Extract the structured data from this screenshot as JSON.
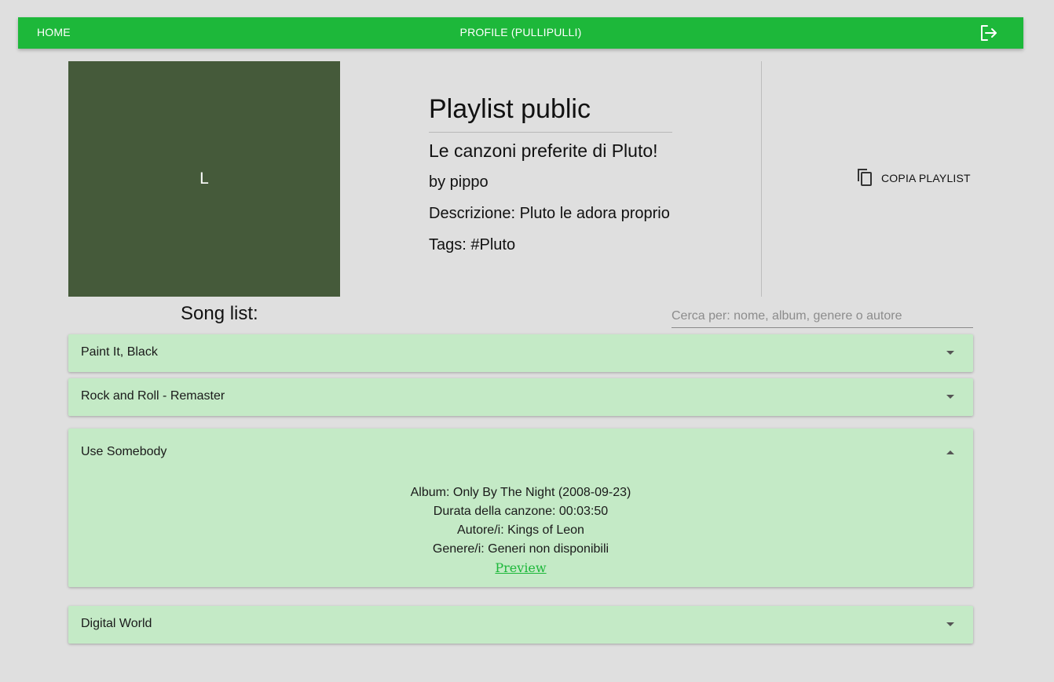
{
  "nav": {
    "home": "HOME",
    "profile": "PROFILE (PULLIPULLI)",
    "logout_icon": "logout-icon"
  },
  "playlist": {
    "cover_letter": "L",
    "cover_color": "#455a3a",
    "title": "Playlist public",
    "name": "Le canzoni preferite di Pluto!",
    "author": "by pippo",
    "description": "Descrizione: Pluto le adora proprio",
    "tags": "Tags: #Pluto"
  },
  "actions": {
    "copy_label": "COPIA PLAYLIST",
    "copy_icon": "copy-icon"
  },
  "songlist": {
    "label": "Song list:",
    "search_placeholder": "Cerca per: nome, album, genere o autore",
    "search_value": ""
  },
  "songs": [
    {
      "title": "Paint It, Black",
      "expanded": false
    },
    {
      "title": "Rock and Roll - Remaster",
      "expanded": false
    },
    {
      "title": "Use Somebody",
      "expanded": true,
      "album": "Album: Only By The Night (2008-09-23)",
      "duration": "Durata della canzone: 00:03:50",
      "artists": "Autore/i: Kings of Leon",
      "genres": "Genere/i: Generi non disponibili",
      "preview": "Preview"
    },
    {
      "title": "Digital World",
      "expanded": false
    }
  ],
  "colors": {
    "accent": "#1db83a",
    "song_bg": "#c4eac6",
    "page_bg": "#dfdfdf"
  }
}
